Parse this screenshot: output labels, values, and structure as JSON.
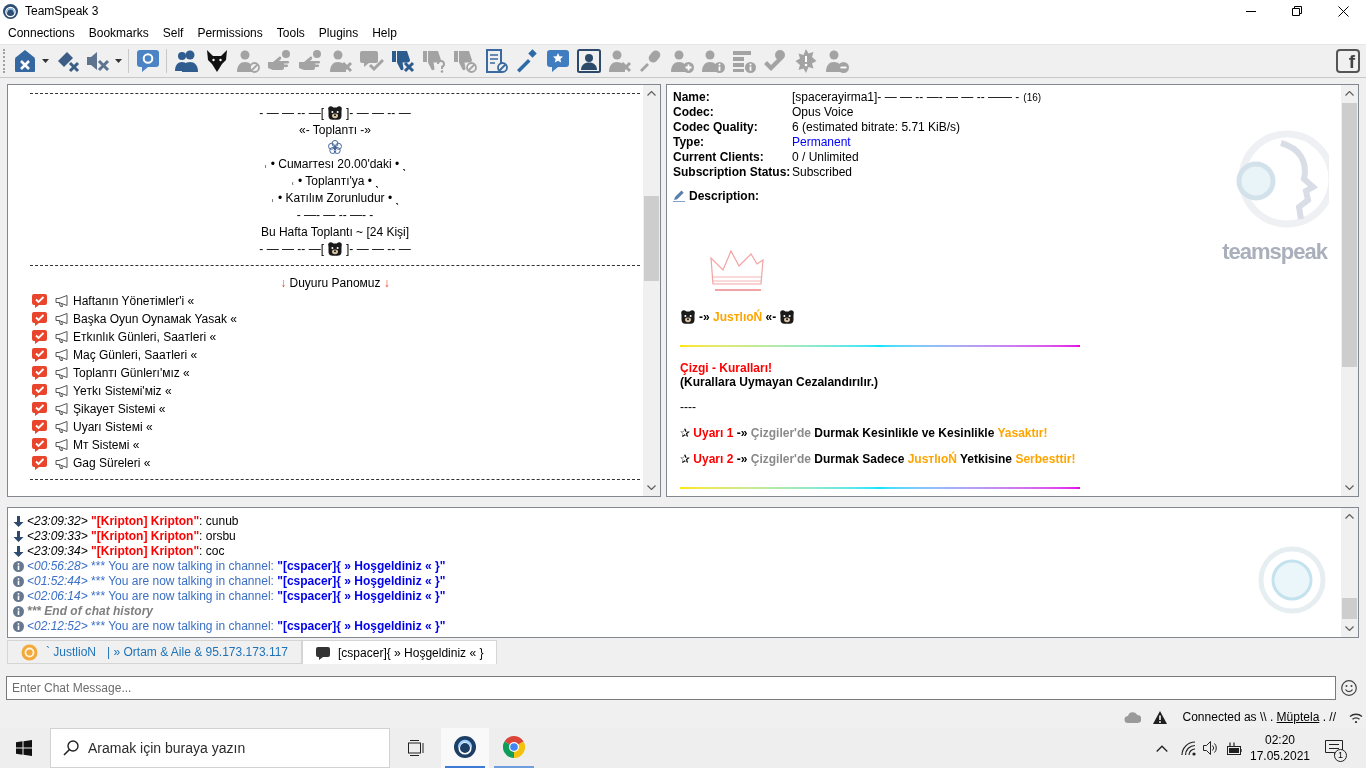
{
  "window": {
    "title": "TeamSpeak 3"
  },
  "menu": [
    "Connections",
    "Bookmarks",
    "Self",
    "Permissions",
    "Tools",
    "Plugins",
    "Help"
  ],
  "toolbar": {
    "groups": [
      [
        {
          "kind": "disconnect",
          "disabled": false,
          "dropdown": true
        },
        {
          "kind": "eraser",
          "disabled": false
        },
        {
          "kind": "speakers",
          "disabled": false,
          "dropdown": true
        }
      ],
      [
        {
          "kind": "away",
          "disabled": false
        }
      ],
      [
        {
          "kind": "contacts",
          "disabled": false
        },
        {
          "kind": "whisper",
          "disabled": false
        },
        {
          "kind": "ban",
          "disabled": true
        },
        {
          "kind": "servergroup",
          "disabled": true
        },
        {
          "kind": "channelgroup",
          "disabled": true
        },
        {
          "kind": "kick",
          "disabled": true
        },
        {
          "kind": "poke",
          "disabled": true
        },
        {
          "kind": "complain",
          "disabled": false
        },
        {
          "kind": "complaints",
          "disabled": true
        },
        {
          "kind": "complaintban",
          "disabled": true
        },
        {
          "kind": "banlist",
          "disabled": false
        },
        {
          "kind": "key",
          "disabled": false
        },
        {
          "kind": "chat",
          "disabled": false
        },
        {
          "kind": "avatar",
          "disabled": false
        },
        {
          "kind": "kickserver",
          "disabled": true
        },
        {
          "kind": "mic",
          "disabled": true
        },
        {
          "kind": "addfriend",
          "disabled": true
        },
        {
          "kind": "clientinfo",
          "disabled": true
        },
        {
          "kind": "serverinfo",
          "disabled": true
        },
        {
          "kind": "verify",
          "disabled": true
        },
        {
          "kind": "plugin",
          "disabled": true
        },
        {
          "kind": "removefriend",
          "disabled": true
        }
      ]
    ],
    "social_label": "f"
  },
  "channel_description": {
    "header": [
      {
        "kind": "emblem",
        "left": "- — — -- —[",
        "right": "]- — — -- —"
      },
      {
        "kind": "text",
        "text": "«- Toplanтı -»"
      },
      {
        "kind": "flower"
      },
      {
        "kind": "text",
        "text": "˓ • Cuмarтesı 20.00'daki • ˎ"
      },
      {
        "kind": "text",
        "text": "˓ • Toplanтı'ya • ˎ"
      },
      {
        "kind": "text",
        "text": "˓ • Kaтılıм Zorunludur • ˎ"
      },
      {
        "kind": "text",
        "text": "- —- — -- —- -"
      },
      {
        "kind": "text",
        "text": "Bu Hafta Toplantı ~ [24 Kişi]"
      },
      {
        "kind": "emblem",
        "left": "- — — -- —[",
        "right": "]- — — -- —"
      }
    ],
    "board": {
      "arrow_left": "↓",
      "title": "Duyuru Panoмuz",
      "arrow_right": "↓",
      "items": [
        "Haftanın Yöneтiмler'i «",
        "Başka Oyun Oynaмak Yasak «",
        "Eтkınlık Günleri, Saaтleri «",
        "Maç Günleri, Saaтleri «",
        "Toplanтı Günlerı'мız «",
        "Yeтkı Sisteмi'мiz «",
        "Şikayeт Sisteмi «",
        "Uyarı Sisteмi «",
        "Mт Sisteмi «",
        "Gag Süreleri «"
      ]
    }
  },
  "info_panel": {
    "properties": [
      {
        "label": "Name:",
        "value": "[spacerayirma1]- — — -- —- — — -- —— -",
        "suffix": "(16)",
        "kind": "text"
      },
      {
        "label": "Codec:",
        "value": "Opus Voice",
        "kind": "text"
      },
      {
        "label": "Codec Quality:",
        "value": "6 (estimated bitrate: 5.71 KiB/s)",
        "kind": "text"
      },
      {
        "label": "Type:",
        "value": "Permanent",
        "kind": "highlight"
      },
      {
        "label": "Current Clients:",
        "value": "0 / Unlimited",
        "kind": "text"
      },
      {
        "label": "Subscription Status:",
        "value": "Subscribed",
        "kind": "text"
      }
    ],
    "description_label": "Description:",
    "signature": {
      "lead": "-»",
      "name": "JusтlıoŃ",
      "trail": "«-"
    },
    "rules_title": "Çizgi - Kuralları!",
    "rules_note": "(Kurallara Uymayan Cezalandırılır.)",
    "separator": "----",
    "rules": [
      {
        "segments": [
          {
            "kind": "symbol",
            "text": "✰"
          },
          {
            "kind": "label",
            "text": "Uyarı 1"
          },
          {
            "kind": "plain",
            "text": "-»"
          },
          {
            "kind": "muted",
            "text": "Çizgiler'de"
          },
          {
            "kind": "plain",
            "text": "Durmak Kesinlikle ve Kesinlikle"
          },
          {
            "kind": "accent",
            "text": "Yasaktır!"
          }
        ]
      },
      {
        "segments": [
          {
            "kind": "symbol",
            "text": "✰"
          },
          {
            "kind": "label",
            "text": "Uyarı 2"
          },
          {
            "kind": "plain",
            "text": "-»"
          },
          {
            "kind": "muted",
            "text": "Çizgiler'de"
          },
          {
            "kind": "plain",
            "text": "Durmak Sadece"
          },
          {
            "kind": "accent",
            "text": "JusтlıoŃ"
          },
          {
            "kind": "plain",
            "text": "Yetkisine"
          },
          {
            "kind": "accent",
            "text": "Serbesttir!"
          }
        ]
      }
    ],
    "logo_text": "teamspeak"
  },
  "chat": {
    "lines": [
      {
        "kind": "message",
        "time": "<23:09:32>",
        "sender": "\"[Kripton] Kripton\"",
        "text": ": cunub"
      },
      {
        "kind": "message",
        "time": "<23:09:33>",
        "sender": "\"[Kripton] Kripton\"",
        "text": ": orsbu"
      },
      {
        "kind": "message",
        "time": "<23:09:34>",
        "sender": "\"[Kripton] Kripton\"",
        "text": ": coc"
      },
      {
        "kind": "info",
        "time": "<00:56:28>",
        "text": "*** You are now talking in channel:",
        "channel": "\"[cspacer]{ » Hoşgeldiniz « }\""
      },
      {
        "kind": "info",
        "time": "<01:52:44>",
        "text": "*** You are now talking in channel:",
        "channel": "\"[cspacer]{ » Hoşgeldiniz « }\""
      },
      {
        "kind": "info",
        "time": "<02:06:14>",
        "text": "*** You are now talking in channel:",
        "channel": "\"[cspacer]{ » Hoşgeldiniz « }\""
      },
      {
        "kind": "notice",
        "text": "*** End of chat history"
      },
      {
        "kind": "info",
        "time": "<02:12:52>",
        "text": "*** You are now talking in channel:",
        "channel": "\"[cspacer]{ » Hoşgeldiniz « }\""
      }
    ]
  },
  "tabs": [
    {
      "kind": "server",
      "label": "` JustlioN",
      "detail": "| » Ortam & Aile & 95.173.173.117",
      "selected": false
    },
    {
      "kind": "channel",
      "label": "[cspacer]{ » Hoşgeldiniz « }",
      "selected": true
    }
  ],
  "chat_input": {
    "placeholder": "Enter Chat Message..."
  },
  "status": {
    "prefix": "Connected as \\\\ .",
    "user": "Müptela",
    "suffix": ". //"
  },
  "taskbar": {
    "search_placeholder": "Aramak için buraya yazın",
    "apps": [
      {
        "kind": "voice",
        "selected": true
      },
      {
        "kind": "browser",
        "selected": false
      }
    ],
    "time": "02:20",
    "date": "17.05.2021",
    "notification_count": "1"
  }
}
